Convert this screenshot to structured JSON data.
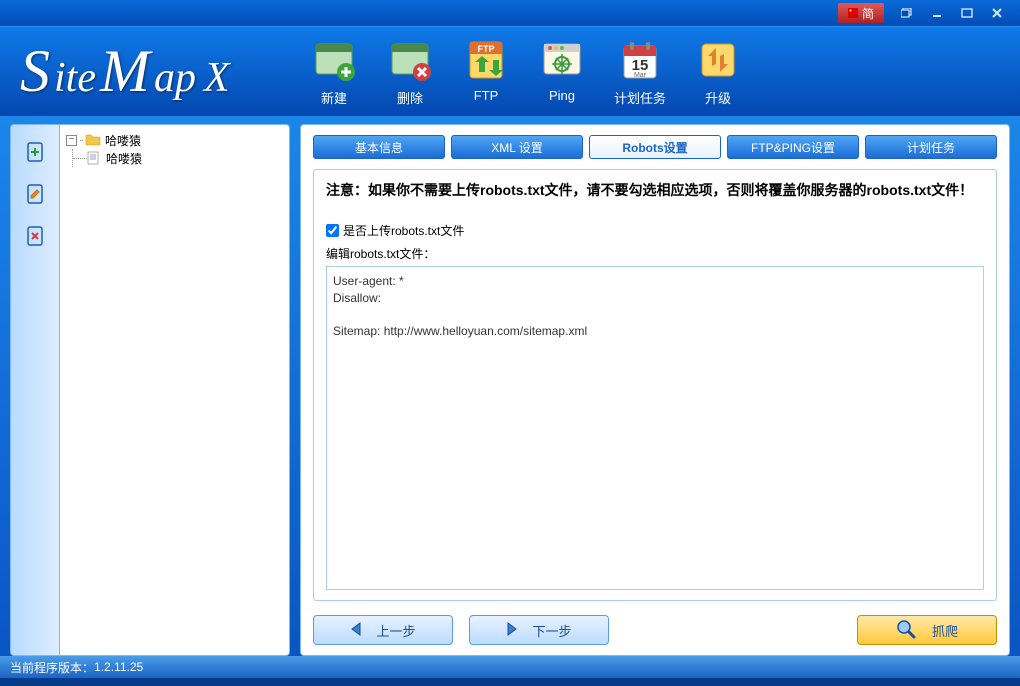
{
  "titlebar": {
    "lang_label": "简"
  },
  "logo": {
    "part1": "S",
    "part2": "ite",
    "part3": "M",
    "part4": "ap",
    "tail": "X"
  },
  "toolbar": {
    "new_label": "新建",
    "delete_label": "删除",
    "ftp_label": "FTP",
    "ping_label": "Ping",
    "schedule_label": "计划任务",
    "upgrade_label": "升级",
    "calendar_day": "15",
    "calendar_month": "Mar"
  },
  "tree": {
    "root_label": "哈喽猿",
    "child_label": "哈喽猿"
  },
  "tabs": {
    "basic": "基本信息",
    "xml": "XML 设置",
    "robots": "Robots设置",
    "ftpping": "FTP&PING设置",
    "schedule": "计划任务"
  },
  "panel": {
    "warning": "注意：如果你不需要上传robots.txt文件，请不要勾选相应选项，否则将覆盖你服务器的robots.txt文件！",
    "checkbox_label": "是否上传robots.txt文件",
    "edit_label": "编辑robots.txt文件：",
    "robots_content": "User-agent: *\nDisallow:\n\nSitemap: http://www.helloyuan.com/sitemap.xml"
  },
  "buttons": {
    "prev": "上一步",
    "next": "下一步",
    "crawl": "抓爬"
  },
  "statusbar": {
    "version_prefix": "当前程序版本：",
    "version": "1.2.11.25"
  }
}
